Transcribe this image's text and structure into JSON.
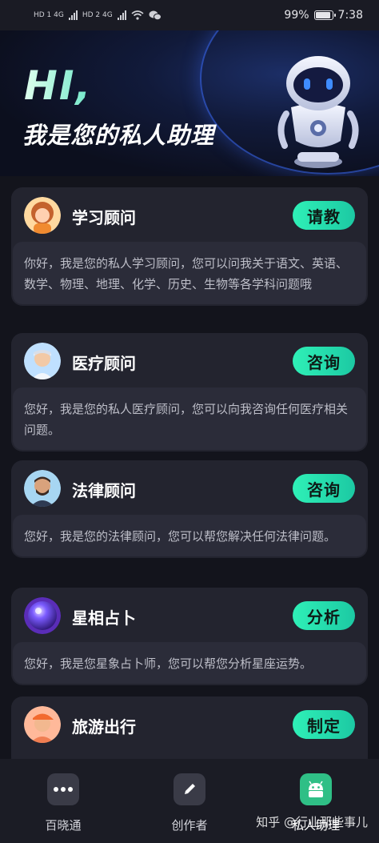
{
  "status_bar": {
    "network_left": "HD 1 4G",
    "network_right": "HD 2 4G",
    "battery": "99%",
    "time": "7:38"
  },
  "hero": {
    "greeting": "HI,",
    "subtitle": "我是您的私人助理"
  },
  "cards": [
    {
      "title": "学习顾问",
      "action": "请教",
      "description": "你好，我是您的私人学习顾问，您可以问我关于语文、英语、数学、物理、地理、化学、历史、生物等各学科问题哦"
    },
    {
      "title": "医疗顾问",
      "action": "咨询",
      "description": "您好，我是您的私人医疗顾问，您可以向我咨询任何医疗相关问题。"
    },
    {
      "title": "法律顾问",
      "action": "咨询",
      "description": "您好，我是您的法律顾问，您可以帮您解决任何法律问题。"
    },
    {
      "title": "星相占卜",
      "action": "分析",
      "description": "您好，我是您星象占卜师，您可以帮您分析星座运势。"
    },
    {
      "title": "旅游出行",
      "action": "制定",
      "description": ""
    }
  ],
  "bottom_nav": [
    {
      "label": "百晓通",
      "icon": "more-dots-icon"
    },
    {
      "label": "创作者",
      "icon": "pencil-icon"
    },
    {
      "label": "私人助理",
      "icon": "android-robot-icon",
      "active": true
    }
  ],
  "watermark": "知乎 @行业那些事儿",
  "colors": {
    "accent": "#2ff0b7",
    "background": "#13141c",
    "card": "#23242f",
    "card_inner": "#2b2c39"
  }
}
